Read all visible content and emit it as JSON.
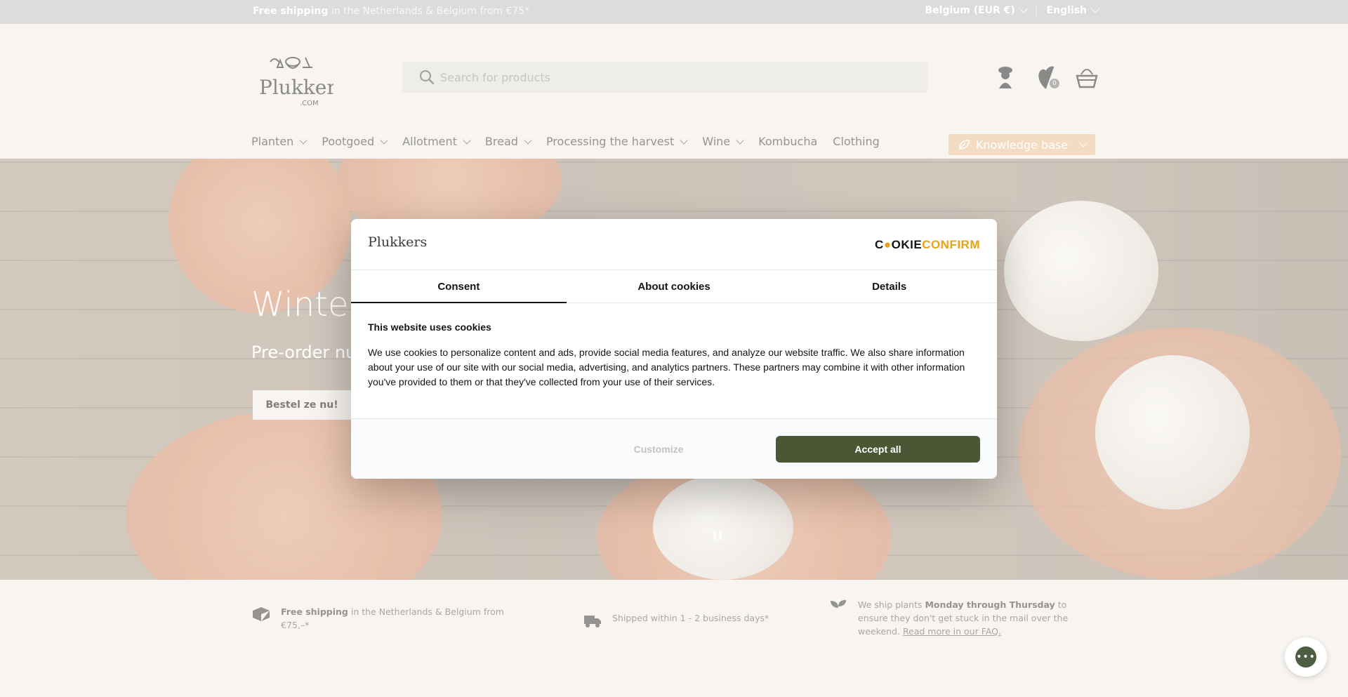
{
  "topbar": {
    "shipping_bold": "Free shipping",
    "shipping_rest": "in the Netherlands & Belgium from €75*",
    "country": "Belgium (EUR €)",
    "separator": "|",
    "language": "English"
  },
  "header": {
    "logo_alt": "Plukkers.com",
    "search_placeholder": "Search for products",
    "wishlist_count": "0",
    "icons": [
      "account-icon",
      "wishlist-icon",
      "cart-icon"
    ]
  },
  "nav": {
    "items": [
      {
        "label": "Planten",
        "dropdown": true
      },
      {
        "label": "Pootgoed",
        "dropdown": true
      },
      {
        "label": "Allotment",
        "dropdown": true
      },
      {
        "label": "Bread",
        "dropdown": true
      },
      {
        "label": "Processing the harvest",
        "dropdown": true
      },
      {
        "label": "Wine",
        "dropdown": true
      },
      {
        "label": "Kombucha",
        "dropdown": false
      },
      {
        "label": "Clothing",
        "dropdown": false
      }
    ],
    "knowledge_base": "Knowledge base"
  },
  "hero": {
    "title": "Winter",
    "subtitle": "Pre-order nu",
    "button": "Bestel ze nu!",
    "pause": "II"
  },
  "usps": {
    "shipping_bold": "Free shipping",
    "shipping_rest": " in the Netherlands & Belgium from €75,–*",
    "delivery": "Shipped within 1 - 2 business days*",
    "plants_pre": "We ship plants ",
    "plants_bold": "Monday through Thursday",
    "plants_post": " to ensure they don't get stuck in the mail over the weekend. ",
    "plants_link": "Read more in our FAQ."
  },
  "cookie": {
    "brand": "Plukkers",
    "provider_a": "C",
    "provider_b": "OKIE",
    "provider_c": "CONFIRM",
    "tabs": [
      "Consent",
      "About cookies",
      "Details"
    ],
    "active_tab": "Consent",
    "heading": "This website uses cookies",
    "body": "We use cookies to personalize content and ads, provide social media features, and analyze our website traffic. We also share information about your use of our site with our social media, advertising, and analytics partners. These partners may combine it with other information you've provided to them or that they've collected from your use of their services.",
    "customize": "Customize",
    "accept": "Accept all"
  },
  "colors": {
    "accent_green": "#4b5634",
    "knowledge_base": "#efc9a4",
    "background": "#f4efe9",
    "topbar": "#c9c9cd"
  }
}
